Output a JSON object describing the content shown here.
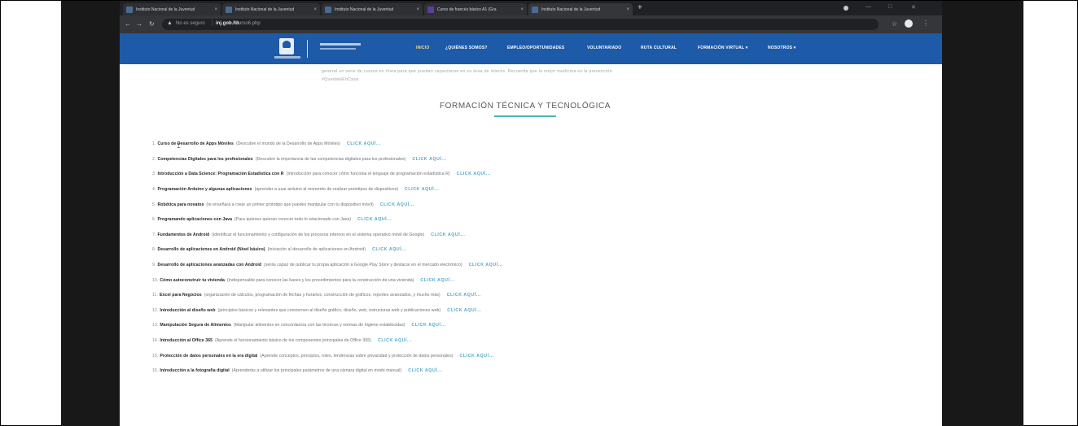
{
  "browser": {
    "tabs": [
      {
        "title": "Instituto Nacional de la Juventud",
        "active": false
      },
      {
        "title": "Instituto Nacional de la Juventud",
        "active": false
      },
      {
        "title": "Instituto Nacional de la Juventud",
        "active": false
      },
      {
        "title": "Curso de francés básico A1 (Gra",
        "active": false
      },
      {
        "title": "Instituto Nacional de la Juventud",
        "active": true
      }
    ],
    "tab_close_glyph": "×",
    "new_tab_glyph": "+",
    "window_controls": [
      "—",
      "□",
      "✕"
    ],
    "address": {
      "security_label": "No es seguro",
      "host": "inj.gob.hn",
      "path": "/Curso6.php"
    },
    "icons": [
      "back-icon",
      "forward-icon",
      "reload-icon",
      "star-icon",
      "profile-icon",
      "menu-icon"
    ],
    "colors": {
      "tabstrip": "#202124",
      "toolbar": "#35363a"
    }
  },
  "site": {
    "nav": {
      "items": [
        {
          "label": "INICIO",
          "active": true
        },
        {
          "label": "¿QUIÉNES SOMOS?",
          "active": false
        },
        {
          "label": "EMPLEO/OPORTUNIDADES",
          "active": false
        },
        {
          "label": "VOLUNTARIADO",
          "active": false
        },
        {
          "label": "RUTA CULTURAL",
          "active": false
        },
        {
          "label": "FORMACIÓN VIRTUAL ▾",
          "active": false
        },
        {
          "label": "NOSOTROS ▾",
          "active": false
        }
      ],
      "colors": {
        "background": "#1d5aa8",
        "active": "#ffd77a"
      }
    },
    "intro": {
      "line1": "general un serie de cursos en línea para que puedan capacitarse en su área de interés. Recuerda que la mejor medicina es la prevención.",
      "line2": "#QuedateEnCasa"
    },
    "section_title": "FORMACIÓN TÉCNICA Y TECNOLÓGICA",
    "link_label": "CLICK AQUÍ...",
    "courses": [
      {
        "num": "1.",
        "name": "Curso de Desarrollo de Apps Móviles",
        "desc": "(Descubre el mundo de la Desarrollo de Apps Móviles)"
      },
      {
        "num": "2.",
        "name": "Competencias Digitales para los profesionales",
        "desc": "(Descubre la importancia de las competencias digitales para los profesionales)"
      },
      {
        "num": "3.",
        "name": "Introducción a Data Science: Programación Estadística con R",
        "desc": "(Introducción para conocer cómo funciona el lenguaje de programación estadística R)"
      },
      {
        "num": "4.",
        "name": "Programación Arduino y algunas aplicaciones",
        "desc": "(aprender a usar arduino al momento de realizar prototipos de dispositivos)"
      },
      {
        "num": "5.",
        "name": "Robótica para novatos",
        "desc": "(te enseñará a crear un primer prototipo que puedes manipular con tu dispositivo móvil)"
      },
      {
        "num": "6.",
        "name": "Programando aplicaciones con Java",
        "desc": "(Para quienes quieran conocer todo lo relacionado con Java)"
      },
      {
        "num": "7.",
        "name": "Fundamentos de Android",
        "desc": "(identificar el funcionamiento y configuración de los procesos internos en el sistema operativo móvil de Google)"
      },
      {
        "num": "8.",
        "name": "Desarrollo de aplicaciones en Android (Nivel básico)",
        "desc": "(iniciación al desarrollo de aplicaciones en Android)"
      },
      {
        "num": "9.",
        "name": "Desarrollo de aplicaciones avanzadas con Android",
        "desc": "(serás capaz de publicar tu propia aplicación a Google Play Store y destacar en el mercado electrónico)"
      },
      {
        "num": "10.",
        "name": "Cómo autoconstruir tu vivienda",
        "desc": "(indispensable para conocer las bases y los procedimientos para la construcción de una vivienda)"
      },
      {
        "num": "11.",
        "name": "Excel para Negocios",
        "desc": "(organización de cálculos, programación de fechas y horarios, construcción de gráficos, reportes avanzados, y mucho más)"
      },
      {
        "num": "12.",
        "name": "Introducción al diseño web",
        "desc": "(principios básicos y relevantes que conciernen al diseño gráfico, diseño, web, estructuras web y publicaciones web)"
      },
      {
        "num": "13.",
        "name": "Manipulación Segura de Alimentos",
        "desc": "(Manipular alimentos en concordancia con las técnicas y normas de higiene establecidas)"
      },
      {
        "num": "14.",
        "name": "Introducción al Office 365",
        "desc": "(Aprende el funcionamiento básico de los componentes principales de Office 365)"
      },
      {
        "num": "15.",
        "name": "Protección de datos personales en la era digital",
        "desc": "(Aprende conceptos, principios, roles, tendencias sobre privacidad y protección de datos personales)"
      },
      {
        "num": "16.",
        "name": "Introducción a la fotografía digital",
        "desc": "(Aprenderás a utilizar los principales parámetros de una cámara digital en modo manual)"
      }
    ],
    "colors": {
      "title_underline": "#4bb3b3",
      "link": "#4da7c9"
    }
  }
}
